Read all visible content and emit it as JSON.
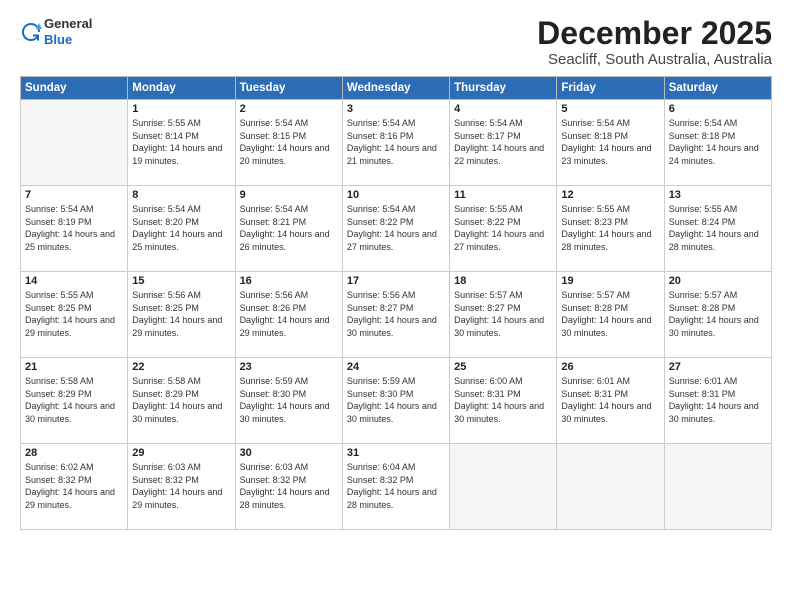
{
  "logo": {
    "general": "General",
    "blue": "Blue"
  },
  "title": "December 2025",
  "subtitle": "Seacliff, South Australia, Australia",
  "headers": [
    "Sunday",
    "Monday",
    "Tuesday",
    "Wednesday",
    "Thursday",
    "Friday",
    "Saturday"
  ],
  "weeks": [
    [
      {
        "day": "",
        "sunrise": "",
        "sunset": "",
        "daylight": ""
      },
      {
        "day": "1",
        "sunrise": "5:55 AM",
        "sunset": "8:14 PM",
        "daylight": "14 hours and 19 minutes."
      },
      {
        "day": "2",
        "sunrise": "5:54 AM",
        "sunset": "8:15 PM",
        "daylight": "14 hours and 20 minutes."
      },
      {
        "day": "3",
        "sunrise": "5:54 AM",
        "sunset": "8:16 PM",
        "daylight": "14 hours and 21 minutes."
      },
      {
        "day": "4",
        "sunrise": "5:54 AM",
        "sunset": "8:17 PM",
        "daylight": "14 hours and 22 minutes."
      },
      {
        "day": "5",
        "sunrise": "5:54 AM",
        "sunset": "8:18 PM",
        "daylight": "14 hours and 23 minutes."
      },
      {
        "day": "6",
        "sunrise": "5:54 AM",
        "sunset": "8:18 PM",
        "daylight": "14 hours and 24 minutes."
      }
    ],
    [
      {
        "day": "7",
        "sunrise": "5:54 AM",
        "sunset": "8:19 PM",
        "daylight": "14 hours and 25 minutes."
      },
      {
        "day": "8",
        "sunrise": "5:54 AM",
        "sunset": "8:20 PM",
        "daylight": "14 hours and 25 minutes."
      },
      {
        "day": "9",
        "sunrise": "5:54 AM",
        "sunset": "8:21 PM",
        "daylight": "14 hours and 26 minutes."
      },
      {
        "day": "10",
        "sunrise": "5:54 AM",
        "sunset": "8:22 PM",
        "daylight": "14 hours and 27 minutes."
      },
      {
        "day": "11",
        "sunrise": "5:55 AM",
        "sunset": "8:22 PM",
        "daylight": "14 hours and 27 minutes."
      },
      {
        "day": "12",
        "sunrise": "5:55 AM",
        "sunset": "8:23 PM",
        "daylight": "14 hours and 28 minutes."
      },
      {
        "day": "13",
        "sunrise": "5:55 AM",
        "sunset": "8:24 PM",
        "daylight": "14 hours and 28 minutes."
      }
    ],
    [
      {
        "day": "14",
        "sunrise": "5:55 AM",
        "sunset": "8:25 PM",
        "daylight": "14 hours and 29 minutes."
      },
      {
        "day": "15",
        "sunrise": "5:56 AM",
        "sunset": "8:25 PM",
        "daylight": "14 hours and 29 minutes."
      },
      {
        "day": "16",
        "sunrise": "5:56 AM",
        "sunset": "8:26 PM",
        "daylight": "14 hours and 29 minutes."
      },
      {
        "day": "17",
        "sunrise": "5:56 AM",
        "sunset": "8:27 PM",
        "daylight": "14 hours and 30 minutes."
      },
      {
        "day": "18",
        "sunrise": "5:57 AM",
        "sunset": "8:27 PM",
        "daylight": "14 hours and 30 minutes."
      },
      {
        "day": "19",
        "sunrise": "5:57 AM",
        "sunset": "8:28 PM",
        "daylight": "14 hours and 30 minutes."
      },
      {
        "day": "20",
        "sunrise": "5:57 AM",
        "sunset": "8:28 PM",
        "daylight": "14 hours and 30 minutes."
      }
    ],
    [
      {
        "day": "21",
        "sunrise": "5:58 AM",
        "sunset": "8:29 PM",
        "daylight": "14 hours and 30 minutes."
      },
      {
        "day": "22",
        "sunrise": "5:58 AM",
        "sunset": "8:29 PM",
        "daylight": "14 hours and 30 minutes."
      },
      {
        "day": "23",
        "sunrise": "5:59 AM",
        "sunset": "8:30 PM",
        "daylight": "14 hours and 30 minutes."
      },
      {
        "day": "24",
        "sunrise": "5:59 AM",
        "sunset": "8:30 PM",
        "daylight": "14 hours and 30 minutes."
      },
      {
        "day": "25",
        "sunrise": "6:00 AM",
        "sunset": "8:31 PM",
        "daylight": "14 hours and 30 minutes."
      },
      {
        "day": "26",
        "sunrise": "6:01 AM",
        "sunset": "8:31 PM",
        "daylight": "14 hours and 30 minutes."
      },
      {
        "day": "27",
        "sunrise": "6:01 AM",
        "sunset": "8:31 PM",
        "daylight": "14 hours and 30 minutes."
      }
    ],
    [
      {
        "day": "28",
        "sunrise": "6:02 AM",
        "sunset": "8:32 PM",
        "daylight": "14 hours and 29 minutes."
      },
      {
        "day": "29",
        "sunrise": "6:03 AM",
        "sunset": "8:32 PM",
        "daylight": "14 hours and 29 minutes."
      },
      {
        "day": "30",
        "sunrise": "6:03 AM",
        "sunset": "8:32 PM",
        "daylight": "14 hours and 28 minutes."
      },
      {
        "day": "31",
        "sunrise": "6:04 AM",
        "sunset": "8:32 PM",
        "daylight": "14 hours and 28 minutes."
      },
      {
        "day": "",
        "sunrise": "",
        "sunset": "",
        "daylight": ""
      },
      {
        "day": "",
        "sunrise": "",
        "sunset": "",
        "daylight": ""
      },
      {
        "day": "",
        "sunrise": "",
        "sunset": "",
        "daylight": ""
      }
    ]
  ]
}
